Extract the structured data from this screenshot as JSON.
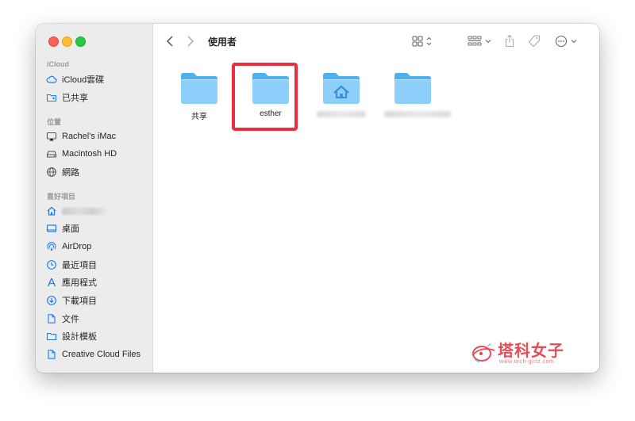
{
  "window": {
    "title": "使用者"
  },
  "sidebar": {
    "sections": [
      {
        "label": "iCloud",
        "items": [
          {
            "label": "iCloud雲碟",
            "icon": "cloud-icon"
          },
          {
            "label": "已共享",
            "icon": "shared-folder-icon"
          }
        ]
      },
      {
        "label": "位置",
        "items": [
          {
            "label": "Rachel's iMac",
            "icon": "imac-icon"
          },
          {
            "label": "Macintosh HD",
            "icon": "hard-drive-icon"
          },
          {
            "label": "網路",
            "icon": "globe-icon"
          }
        ]
      },
      {
        "label": "喜好項目",
        "items": [
          {
            "label": "",
            "icon": "home-icon",
            "blurred": true
          },
          {
            "label": "桌面",
            "icon": "desktop-icon"
          },
          {
            "label": "AirDrop",
            "icon": "airdrop-icon"
          },
          {
            "label": "最近項目",
            "icon": "clock-icon"
          },
          {
            "label": "應用程式",
            "icon": "applications-icon"
          },
          {
            "label": "下載項目",
            "icon": "download-icon"
          },
          {
            "label": "文件",
            "icon": "document-icon"
          },
          {
            "label": "設計模板",
            "icon": "folder-icon"
          },
          {
            "label": "Creative Cloud Files",
            "icon": "file-icon"
          }
        ]
      }
    ]
  },
  "content": {
    "folders": [
      {
        "label": "共享",
        "icon": "folder-icon",
        "blurred": false,
        "highlighted": false
      },
      {
        "label": "esther",
        "icon": "folder-icon",
        "blurred": false,
        "highlighted": true
      },
      {
        "label": "",
        "icon": "home-folder-icon",
        "blurred": true,
        "highlighted": false
      },
      {
        "label": "",
        "icon": "folder-icon",
        "blurred": true,
        "highlighted": false
      }
    ]
  },
  "watermark": {
    "text": "塔科女子",
    "url": "www.tech-girlz.com"
  },
  "colors": {
    "folder_light": "#8ccffb",
    "folder_dark": "#4fb0f0",
    "accent_blue": "#1a7ff0",
    "highlight_red": "#ee2d3e",
    "sidebar_bg": "#ececed",
    "watermark_red": "#e84c56"
  }
}
